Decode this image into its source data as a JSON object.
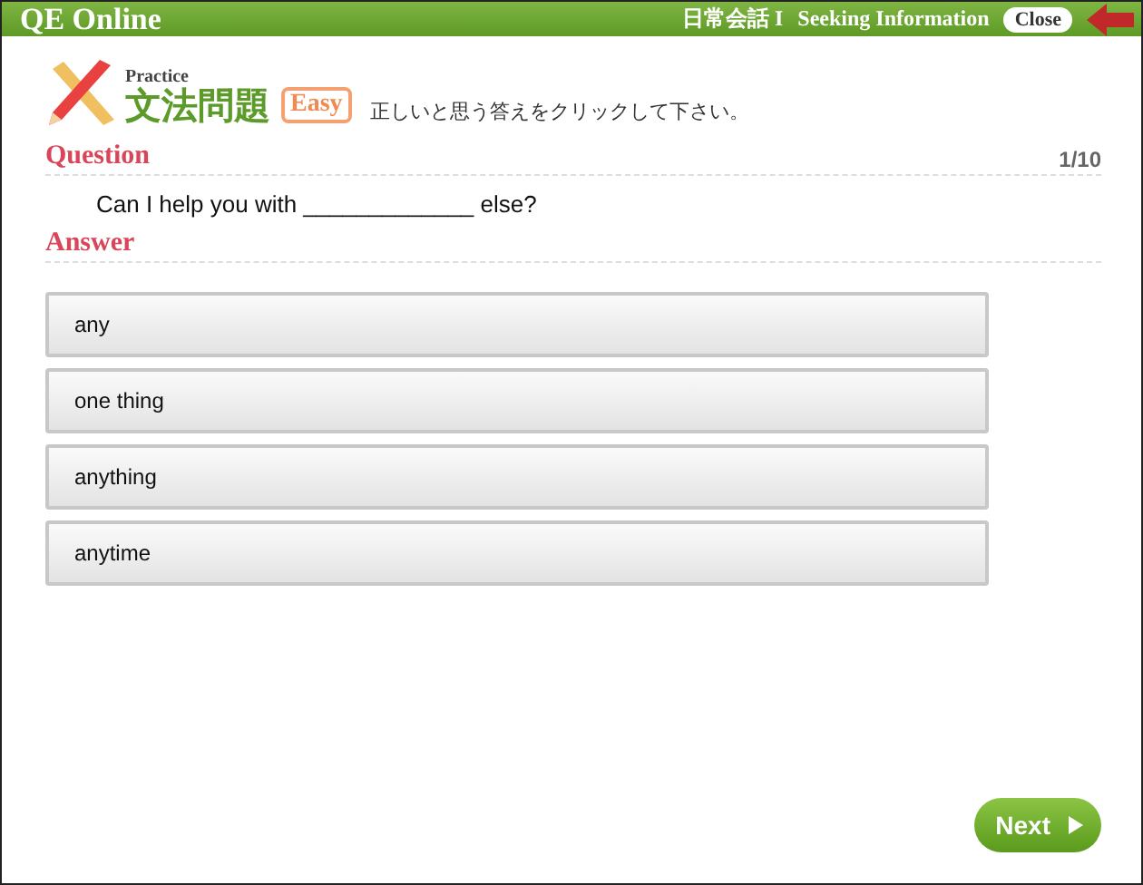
{
  "header": {
    "title": "QE Online",
    "course": "日常会話 I",
    "lesson": "Seeking Information",
    "close_label": "Close"
  },
  "exercise": {
    "subtitle": "Practice",
    "title": "文法問題",
    "level": "Easy",
    "instruction": "正しいと思う答えをクリックして下さい。"
  },
  "question": {
    "heading": "Question",
    "progress": "1/10",
    "text": "Can I help you with _____________ else?"
  },
  "answer": {
    "heading": "Answer",
    "options": [
      {
        "label": "any"
      },
      {
        "label": "one thing"
      },
      {
        "label": "anything"
      },
      {
        "label": "anytime"
      }
    ]
  },
  "next_label": "Next"
}
